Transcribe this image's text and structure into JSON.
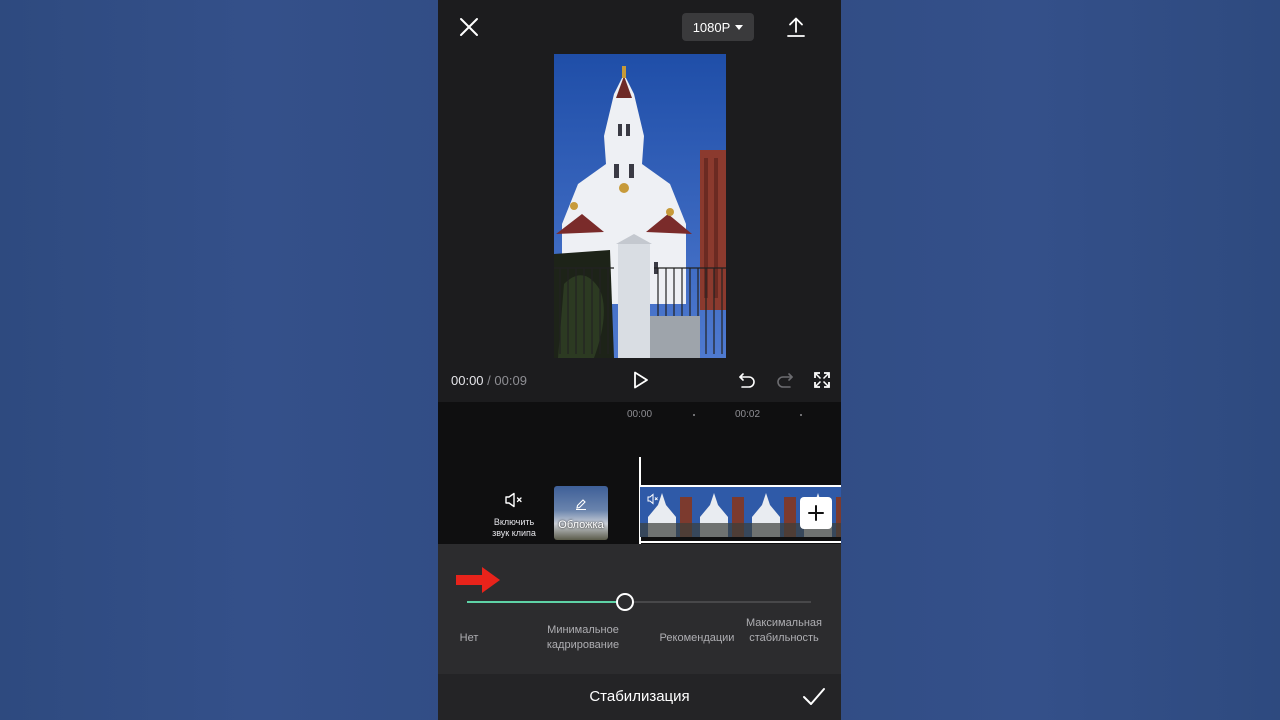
{
  "topbar": {
    "close_icon": "close-icon",
    "resolution_label": "1080P",
    "export_icon": "upload-icon"
  },
  "player": {
    "current_time": "00:00",
    "separator": "/",
    "total_time": "00:09",
    "play_icon": "play-icon",
    "undo_icon": "undo-icon",
    "redo_icon": "redo-icon",
    "fullscreen_icon": "fullscreen-icon"
  },
  "timeline": {
    "ruler_labels": [
      "00:00",
      "00:02"
    ],
    "mute_label": "Включить звук клипа",
    "cover_label": "Обложка",
    "add_icon": "plus-icon"
  },
  "stabilization": {
    "options": [
      "Нет",
      "Минимальное кадрирование",
      "Рекомендации",
      "Максимальная стабильность"
    ],
    "selected_index": 1,
    "slider_value": 0.46,
    "accent_color": "#5ed3a6",
    "annotation_color": "#e8231b"
  },
  "bottombar": {
    "title": "Стабилизация",
    "confirm_icon": "checkmark-icon"
  }
}
